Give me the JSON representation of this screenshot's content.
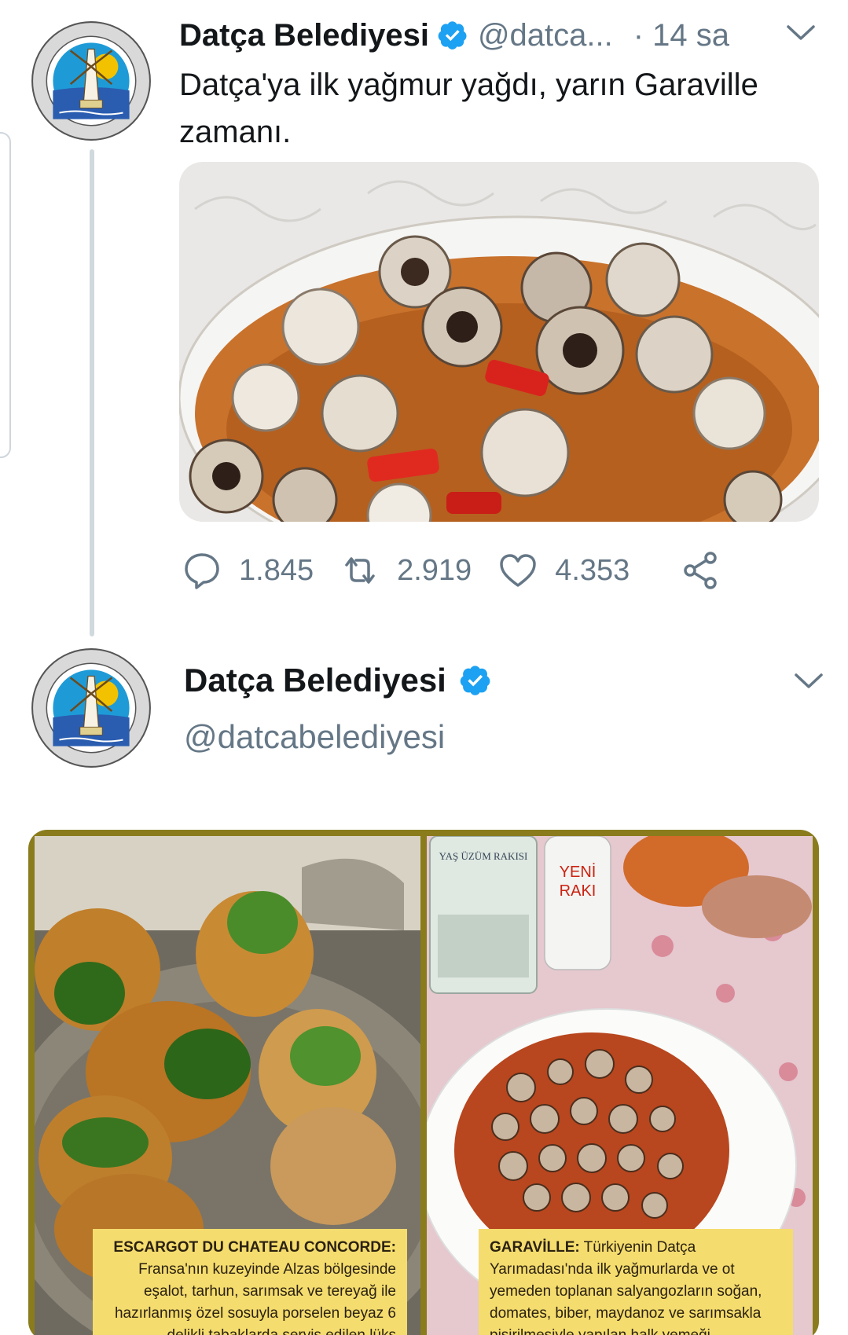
{
  "tweet1": {
    "display_name": "Datça Belediyesi",
    "handle": "@datca...",
    "time": "· 14 sa",
    "text": "Datça'ya ilk yağmur yağdı, yarın Garaville zamanı.",
    "media_description": "snail stew in a white plate",
    "actions": {
      "reply_count": "1.845",
      "retweet_count": "2.919",
      "like_count": "4.353"
    }
  },
  "tweet2": {
    "display_name": "Datça Belediyesi",
    "handle": "@datcabelediyesi",
    "media": {
      "left_caption_title": "ESCARGOT DU CHATEAU CONCORDE:",
      "left_caption_body": "Fransa'nın kuzeyinde Alzas bölgesinde eşalot, tarhun, sarımsak ve tereyağ ile hazırlanmış özel sosuyla porselen beyaz 6 delikli tabaklarda servis edilen lüks salyangoz yemeği",
      "right_caption_title": "GARAVİLLE:",
      "right_caption_body": "Türkiyenin Datça Yarımadası'nda ilk yağmurlarda ve ot yemeden toplanan salyangozların soğan, domates, biber, maydanoz ve sarımsakla pişirilmesiyle yapılan halk yemeği",
      "bottle1_label": "YAŞ ÜZÜM RAKISI",
      "bottle2_label_line1": "YENİ",
      "bottle2_label_line2": "RAKI"
    }
  },
  "avatar_ring_text": "DATÇA BELEDİYESİ",
  "avatar_bottom_text": "MUNICIPALITY OF DATÇA-TURKEY",
  "avatar_year": "1928",
  "colors": {
    "accent": "#1da1f2",
    "secondary_text": "#657786",
    "thread_line": "#cfd9de"
  },
  "icons": [
    "reply-icon",
    "retweet-icon",
    "like-icon",
    "share-icon",
    "verified-badge-icon",
    "chevron-down-icon"
  ]
}
